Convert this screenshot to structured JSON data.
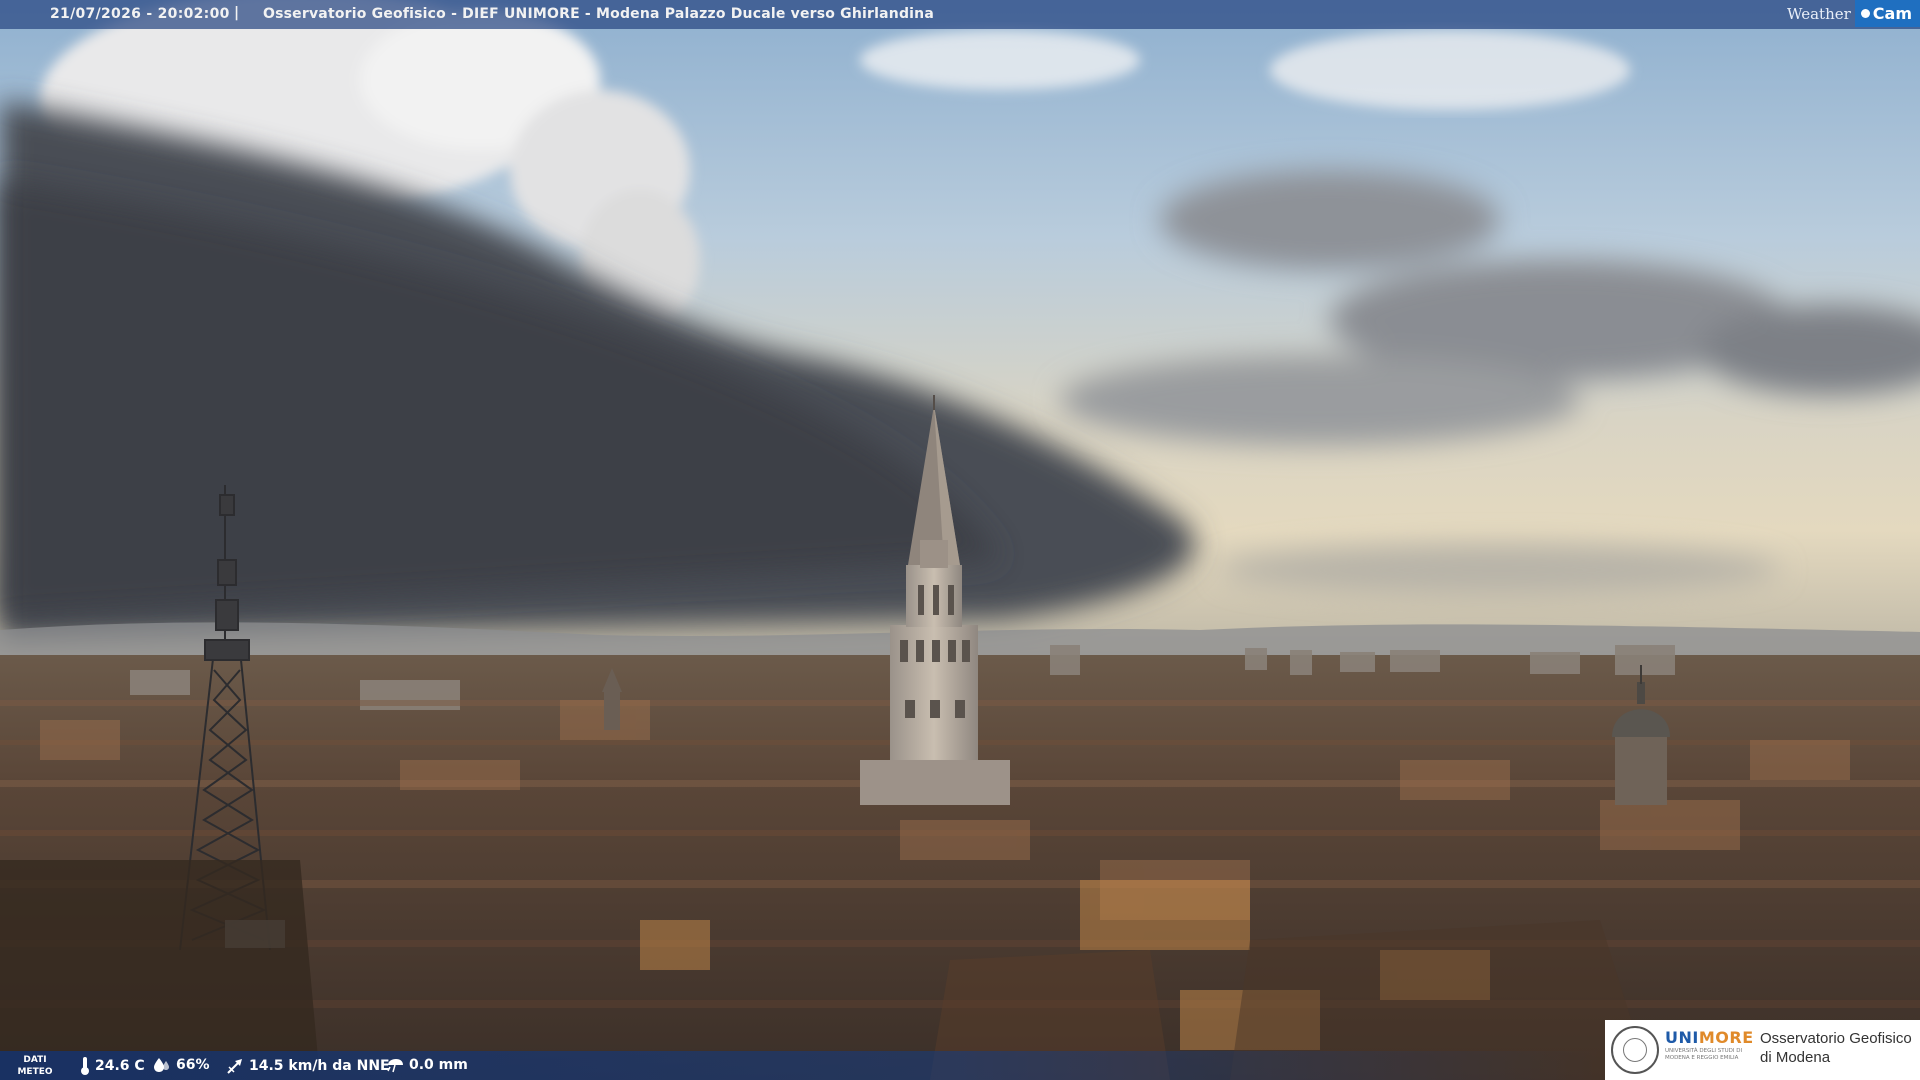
{
  "overlay": {
    "timestamp": "21/07/2026 - 20:02:00",
    "separator": "|",
    "title": "Osservatorio Geofisico - DIEF UNIMORE - Modena Palazzo Ducale verso Ghirlandina",
    "brand_weather": "Weather",
    "brand_cam": "Cam"
  },
  "weather": {
    "label_line1": "DATI",
    "label_line2": "METEO",
    "temperature": "24.6 C",
    "humidity": "66%",
    "wind": "14.5 km/h da NNE",
    "rain": "0.0 mm"
  },
  "logo": {
    "brand_uni": "UNI",
    "brand_more": "MORE",
    "brand_subtitle": "UNIVERSITÀ DEGLI STUDI DI MODENA E REGGIO EMILIA",
    "observatory_line1": "Osservatorio Geofisico",
    "observatory_line2": "di Modena"
  },
  "icons": {
    "temperature": "thermometer-icon",
    "humidity": "drop-icon",
    "wind": "wind-direction-icon",
    "rain": "rain-gauge-icon",
    "cam": "camera-dot-icon"
  },
  "colors": {
    "overlay_bar": "#2d4f8c",
    "cam_badge": "#1f6fc0",
    "unimore_blue": "#1e5aa8",
    "unimore_orange": "#e08a2a"
  }
}
